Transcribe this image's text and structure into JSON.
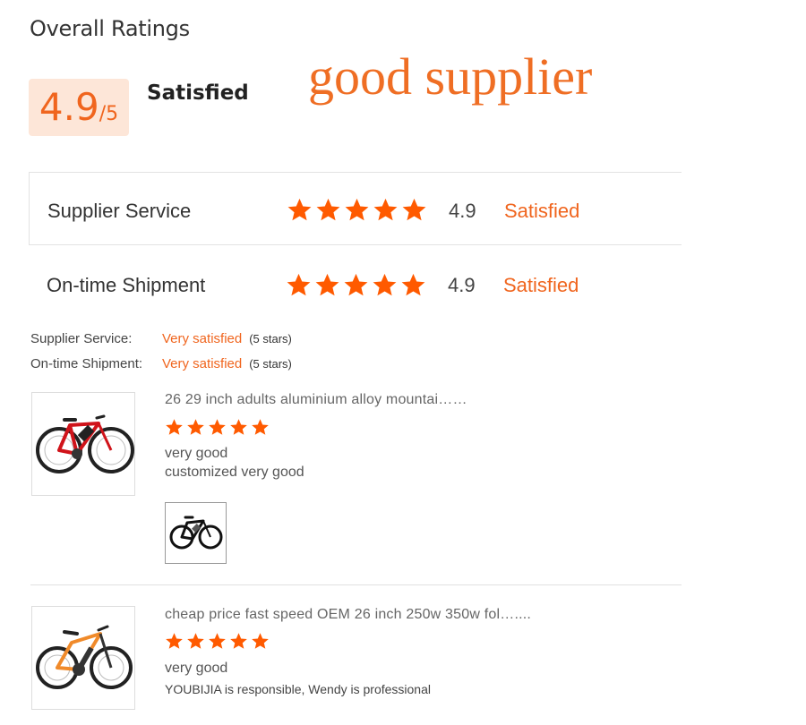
{
  "header": {
    "title": "Overall Ratings",
    "score": "4.9",
    "score_denominator": "/5",
    "overall_status": "Satisfied",
    "banner": "good supplier"
  },
  "ratings": [
    {
      "label": "Supplier Service",
      "stars": 5,
      "value": "4.9",
      "status": "Satisfied"
    },
    {
      "label": "On-time Shipment",
      "stars": 5,
      "value": "4.9",
      "status": "Satisfied"
    }
  ],
  "details": [
    {
      "label": "Supplier Service:",
      "value": "Very satisfied",
      "stars_text": "(5 stars)"
    },
    {
      "label": "On-time Shipment:",
      "value": "Very satisfied",
      "stars_text": "(5 stars)"
    }
  ],
  "reviews": [
    {
      "product": "26 29 inch adults aluminium alloy mountai……",
      "stars": 5,
      "comment_line1": "very good",
      "comment_line2": "customized very good",
      "thumb_icon": "red-mountain-ebike",
      "attached_icon": "black-mountain-ebike"
    },
    {
      "product": "cheap price fast speed OEM 26 inch 250w 350w fol…....",
      "stars": 5,
      "comment_line1": "very good",
      "comment_line2": "YOUBIJIA is responsible, Wendy is professional",
      "thumb_icon": "orange-full-suspension-ebike"
    }
  ],
  "colors": {
    "accent": "#f0651e",
    "score_bg": "#fde6d8",
    "star": "#ff5a00"
  }
}
